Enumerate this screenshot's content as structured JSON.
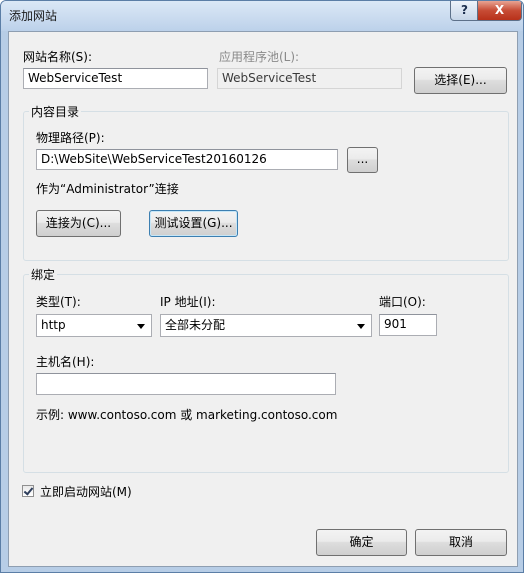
{
  "window": {
    "title": "添加网站",
    "help_label": "?",
    "close_label": "X"
  },
  "site": {
    "name_label": "网站名称(S):",
    "name_value": "WebServiceTest",
    "pool_label": "应用程序池(L):",
    "pool_value": "WebServiceTest",
    "select_button": "选择(E)..."
  },
  "content": {
    "group_label": "内容目录",
    "path_label": "物理路径(P):",
    "path_value": "D:\\WebSite\\WebServiceTest20160126",
    "browse_button": "...",
    "connect_as_text": "作为“Administrator”连接",
    "connect_as_button": "连接为(C)...",
    "test_settings_button": "测试设置(G)..."
  },
  "binding": {
    "group_label": "绑定",
    "type_label": "类型(T):",
    "type_value": "http",
    "ip_label": "IP 地址(I):",
    "ip_value": "全部未分配",
    "port_label": "端口(O):",
    "port_value": "901",
    "host_label": "主机名(H):",
    "host_value": "",
    "example_text": "示例: www.contoso.com 或 marketing.contoso.com"
  },
  "start_site": {
    "label": "立即启动网站(M)",
    "checked": true
  },
  "footer": {
    "ok_button": "确定",
    "cancel_button": "取消"
  }
}
